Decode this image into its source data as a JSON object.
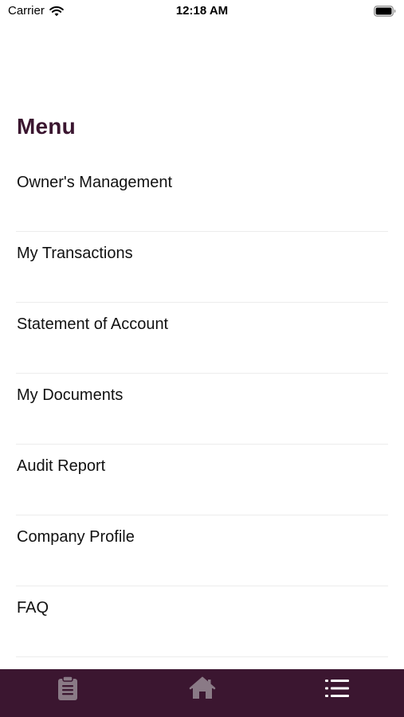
{
  "status_bar": {
    "carrier": "Carrier",
    "time": "12:18 AM"
  },
  "menu": {
    "title": "Menu",
    "items": [
      {
        "label": "Owner's Management"
      },
      {
        "label": "My Transactions"
      },
      {
        "label": "Statement of Account"
      },
      {
        "label": "My Documents"
      },
      {
        "label": "Audit Report"
      },
      {
        "label": "Company Profile"
      },
      {
        "label": "FAQ"
      }
    ]
  },
  "tab_bar": {
    "background_color": "#3b1630",
    "inactive_icon_color": "#8a7a86",
    "active_icon_color": "#ffffff",
    "tabs": [
      {
        "icon": "clipboard-icon",
        "active": false
      },
      {
        "icon": "home-icon",
        "active": false
      },
      {
        "icon": "list-icon",
        "active": true
      }
    ]
  },
  "colors": {
    "title": "#3b1630",
    "divider": "#ececec"
  }
}
